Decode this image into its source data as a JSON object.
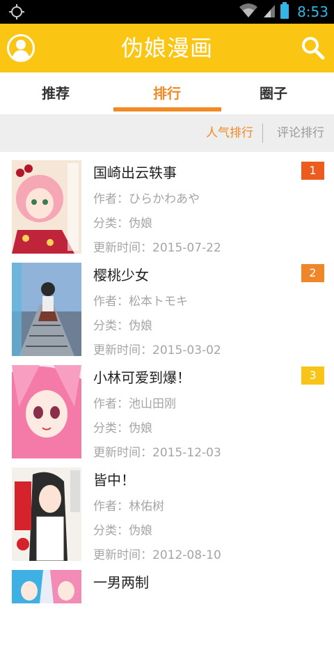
{
  "status_bar": {
    "time": "8:53",
    "icons": [
      "target-icon",
      "wifi-icon",
      "signal-icon",
      "battery-icon"
    ],
    "time_color": "#33b5e5"
  },
  "app_bar": {
    "title": "伪娘漫画",
    "color": "#fbc613",
    "left_icon": "avatar-icon",
    "right_icon": "search-icon"
  },
  "tabs": [
    {
      "label": "推荐",
      "active": false
    },
    {
      "label": "排行",
      "active": true
    },
    {
      "label": "圈子",
      "active": false
    }
  ],
  "accent_color": "#ef8a26",
  "sort": {
    "hot": "人气排行",
    "comment": "评论排行"
  },
  "items": [
    {
      "title": "国崎出云轶事",
      "author": "作者：ひらかわあや",
      "category": "分类：伪娘",
      "date": "更新时间：2015-07-22",
      "rank": "1",
      "rank_color": "#ec5c1e"
    },
    {
      "title": "樱桃少女",
      "author": "作者：松本トモキ",
      "category": "分类：伪娘",
      "date": "更新时间：2015-03-02",
      "rank": "2",
      "rank_color": "#f0862a"
    },
    {
      "title": "小林可爱到爆！",
      "author": "作者：池山田刚",
      "category": "分类：伪娘",
      "date": "更新时间：2015-12-03",
      "rank": "3",
      "rank_color": "#f7c417"
    },
    {
      "title": "皆中！",
      "author": "作者：林佑树",
      "category": "分类：伪娘",
      "date": "更新时间：2012-08-10"
    },
    {
      "title": "一男两制"
    }
  ]
}
